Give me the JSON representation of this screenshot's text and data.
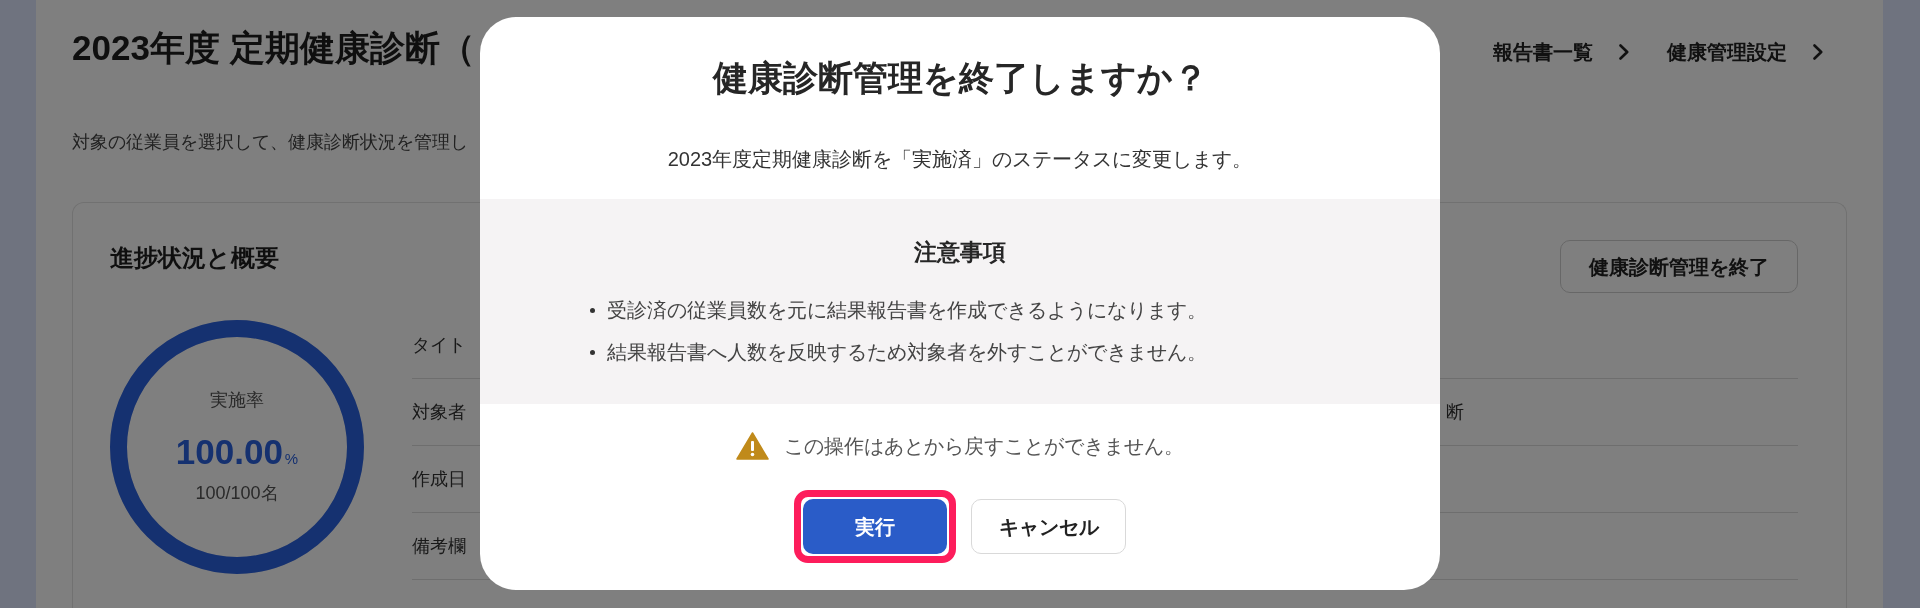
{
  "page": {
    "title": "2023年度 定期健康診断（",
    "description": "対象の従業員を選択して、健康診断状況を管理し",
    "breadcrumbs": [
      {
        "label": "報告書一覧"
      },
      {
        "label": "健康管理設定"
      }
    ]
  },
  "summary": {
    "title": "進捗状況と概要",
    "end_button": "健康診断管理を終了",
    "progress": {
      "label": "実施率",
      "rate": "100.00",
      "unit": "%",
      "count": "100/100名",
      "level": 1
    },
    "rows": [
      {
        "label": "タイト"
      },
      {
        "label": "対象者",
        "value": "断"
      },
      {
        "label": "作成日"
      },
      {
        "label": "備考欄"
      }
    ]
  },
  "dialog": {
    "title": "健康診断管理を終了しますか？",
    "message": "2023年度定期健康診断を「実施済」のステータスに変更します。",
    "notes": {
      "title": "注意事項",
      "items": [
        "受診済の従業員数を元に結果報告書を作成できるようになります。",
        "結果報告書へ人数を反映するため対象者を外すことができません。"
      ]
    },
    "warning": "この操作はあとから戻すことができません。",
    "buttons": [
      {
        "label": "実行",
        "kind": "primary",
        "highlighted": true
      },
      {
        "label": "キャンセル",
        "kind": "secondary",
        "highlighted": false
      }
    ]
  }
}
